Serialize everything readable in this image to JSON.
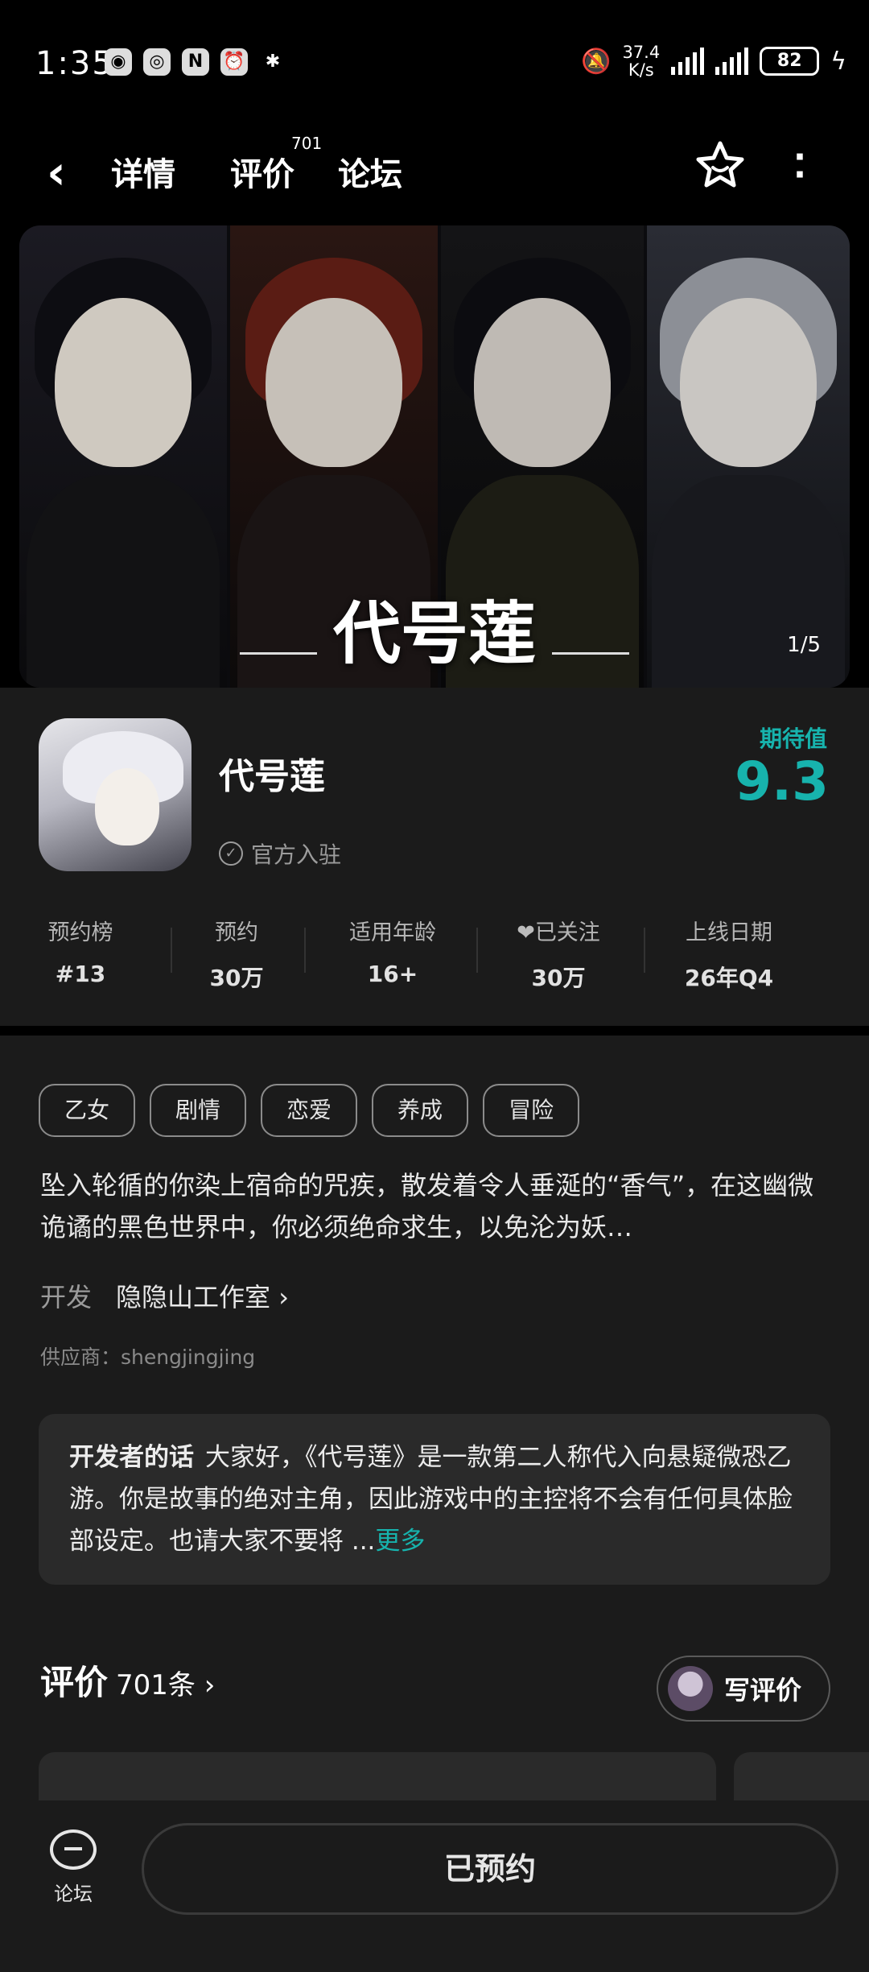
{
  "status_bar": {
    "time": "1:35",
    "net_speed": "37.4",
    "net_unit": "K/s",
    "battery": "82"
  },
  "nav": {
    "tabs": [
      {
        "label": "详情",
        "active": true
      },
      {
        "label": "评价",
        "active": false
      },
      {
        "label": "论坛",
        "active": false
      }
    ],
    "review_count_badge": "701"
  },
  "banner": {
    "title": "代号莲",
    "page_indicator": "1/5"
  },
  "game": {
    "name": "代号莲",
    "official_label": "官方入驻",
    "expectation_label": "期待值",
    "expectation_value": "9.3"
  },
  "stats": [
    {
      "label": "预约榜",
      "value": "#13"
    },
    {
      "label": "预约",
      "value": "30万"
    },
    {
      "label": "适用年龄",
      "value": "16+"
    },
    {
      "label": "已关注",
      "value": "30万"
    },
    {
      "label": "上线日期",
      "value": "26年Q4"
    }
  ],
  "tags": [
    "乙女",
    "剧情",
    "恋爱",
    "养成",
    "冒险"
  ],
  "description": "坠入轮循的你染上宿命的咒疾，散发着令人垂涎的“香气”，在这幽微诡谲的黑色世界中，你必须绝命求生，以免沦为妖…",
  "developer": {
    "label": "开发",
    "name": "隐隐山工作室 ›"
  },
  "supplier": "供应商：shengjingjing",
  "dev_words": {
    "title": "开发者的话",
    "text": "大家好，《代号莲》是一款第二人称代入向悬疑微恐乙游。你是故事的绝对主角，因此游戏中的主控将不会有任何具体脸部设定。也请大家不要将 ...",
    "more": "更多"
  },
  "reviews": {
    "title": "评价",
    "count": "701条 ›",
    "write_label": "写评价"
  },
  "bottom": {
    "forum_label": "论坛",
    "main_button": "已预约"
  },
  "colors": {
    "accent": "#17b3ad",
    "background": "#1b1b1b"
  }
}
